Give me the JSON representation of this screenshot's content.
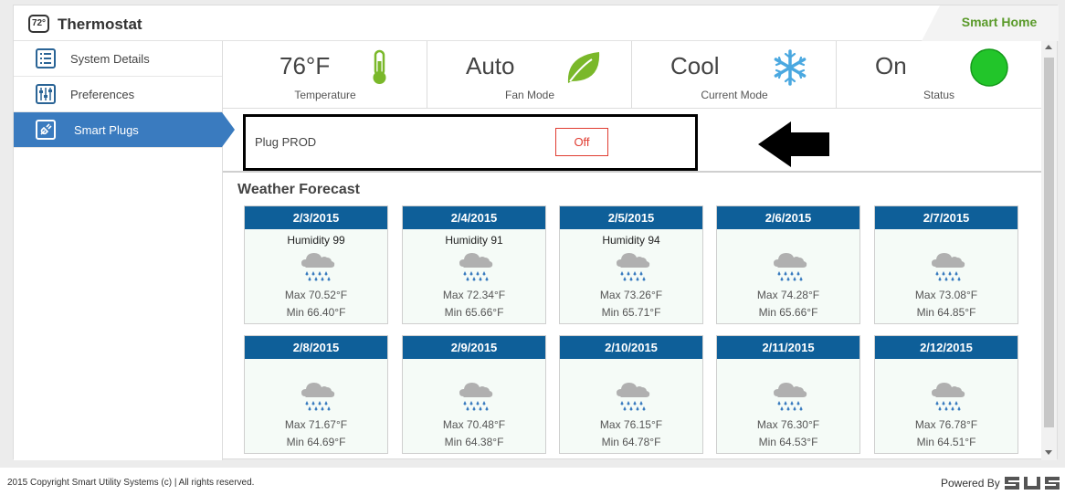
{
  "header": {
    "logo_badge": "72°",
    "title": "Thermostat",
    "smart_home": "Smart Home"
  },
  "sidebar": {
    "items": [
      {
        "label": "System Details",
        "icon": "list-icon"
      },
      {
        "label": "Preferences",
        "icon": "sliders-icon"
      },
      {
        "label": "Smart Plugs",
        "icon": "plug-icon",
        "active": true
      }
    ]
  },
  "status": [
    {
      "value": "76°F",
      "label": "Temperature",
      "icon": "thermometer-icon"
    },
    {
      "value": "Auto",
      "label": "Fan Mode",
      "icon": "leaf-icon"
    },
    {
      "value": "Cool",
      "label": "Current Mode",
      "icon": "snowflake-icon"
    },
    {
      "value": "On",
      "label": "Status",
      "icon": "green-dot-icon"
    }
  ],
  "plug": {
    "name": "Plug PROD",
    "button": "Off"
  },
  "weather": {
    "title": "Weather Forecast",
    "days": [
      {
        "date": "2/3/2015",
        "humidity": "Humidity 99",
        "max": "Max 70.52°F",
        "min": "Min 66.40°F"
      },
      {
        "date": "2/4/2015",
        "humidity": "Humidity 91",
        "max": "Max 72.34°F",
        "min": "Min 65.66°F"
      },
      {
        "date": "2/5/2015",
        "humidity": "Humidity 94",
        "max": "Max 73.26°F",
        "min": "Min 65.71°F"
      },
      {
        "date": "2/6/2015",
        "humidity": "",
        "max": "Max 74.28°F",
        "min": "Min 65.66°F"
      },
      {
        "date": "2/7/2015",
        "humidity": "",
        "max": "Max 73.08°F",
        "min": "Min 64.85°F"
      },
      {
        "date": "2/8/2015",
        "humidity": "",
        "max": "Max 71.67°F",
        "min": "Min 64.69°F"
      },
      {
        "date": "2/9/2015",
        "humidity": "",
        "max": "Max 70.48°F",
        "min": "Min 64.38°F"
      },
      {
        "date": "2/10/2015",
        "humidity": "",
        "max": "Max 76.15°F",
        "min": "Min 64.78°F"
      },
      {
        "date": "2/11/2015",
        "humidity": "",
        "max": "Max 76.30°F",
        "min": "Min 64.53°F"
      },
      {
        "date": "2/12/2015",
        "humidity": "",
        "max": "Max 76.78°F",
        "min": "Min 64.51°F"
      }
    ]
  },
  "footer": {
    "copyright": "2015 Copyright Smart Utility Systems (c) | All rights reserved.",
    "powered_by": "Powered By",
    "brand": "SUS"
  },
  "colors": {
    "accent_blue": "#3a7bbf",
    "day_header": "#0e5f99",
    "smart_home_green": "#5a9a2a",
    "off_red": "#e03c31",
    "status_green": "#22c52a"
  }
}
